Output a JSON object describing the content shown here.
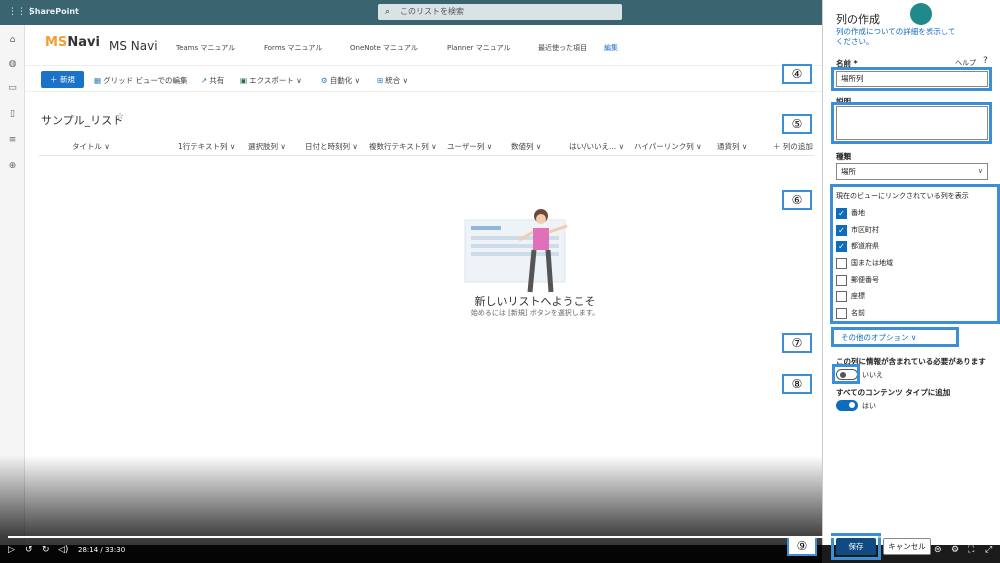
{
  "topbar": {
    "brand": "SharePoint",
    "search_placeholder": "このリストを検索"
  },
  "site": {
    "logo_ms": "MS",
    "logo_navi": "Navi",
    "name": "MS Navi",
    "nav": [
      "Teams マニュアル",
      "Forms マニュアル",
      "OneNote マニュアル",
      "Planner マニュアル",
      "最近使った項目"
    ],
    "edit_label": "編集"
  },
  "commands": {
    "new_label": "新規",
    "grid_edit": "グリッド ビューでの編集",
    "share": "共有",
    "export": "エクスポート",
    "automate": "自動化",
    "integrate": "統合"
  },
  "list": {
    "title": "サンプル_リスト",
    "columns": [
      "タイトル",
      "1行テキスト列",
      "選択肢列",
      "日付と時刻列",
      "複数行テキスト列",
      "ユーザー列",
      "数値列",
      "はい/いいえ...",
      "ハイパーリンク列",
      "通貨列"
    ],
    "add_column": "＋ 列の追加",
    "welcome_title": "新しいリストへようこそ",
    "welcome_sub": "始めるには [新規] ボタンを選択します。"
  },
  "panel": {
    "title": "列の作成",
    "learn_more": "列の作成についての詳細を表示してください。",
    "name_label": "名前 *",
    "name_value": "場所列",
    "desc_label": "説明",
    "type_label": "種類",
    "type_value": "場所",
    "linked_label": "現在のビューにリンクされている列を表示",
    "linked_columns": [
      {
        "label": "番地",
        "checked": true
      },
      {
        "label": "市区町村",
        "checked": true
      },
      {
        "label": "都道府県",
        "checked": true
      },
      {
        "label": "国または地域",
        "checked": false
      },
      {
        "label": "郵便番号",
        "checked": false
      },
      {
        "label": "座標",
        "checked": false
      },
      {
        "label": "名前",
        "checked": false
      }
    ],
    "more_options": "その他のオプション ∨",
    "required_label": "この列に情報が含まれている必要があります",
    "required_value": "いいえ",
    "content_types_label": "すべてのコンテンツ タイプに追加",
    "content_types_value": "はい",
    "save": "保存",
    "cancel": "キャンセル"
  },
  "overlay": {
    "video_settings": "ビデオの設定",
    "video_about": "ビデオについて",
    "comments": "コメント",
    "help": "ヘルプ"
  },
  "markers": [
    "④",
    "⑤",
    "⑥",
    "⑦",
    "⑧",
    "⑨"
  ],
  "video": {
    "time": "28:14 / 33:30",
    "progress": 0.84
  },
  "colors": {
    "accent": "#0f6cbd",
    "callout": "#3b8fd6",
    "topbar": "#3a6470"
  }
}
